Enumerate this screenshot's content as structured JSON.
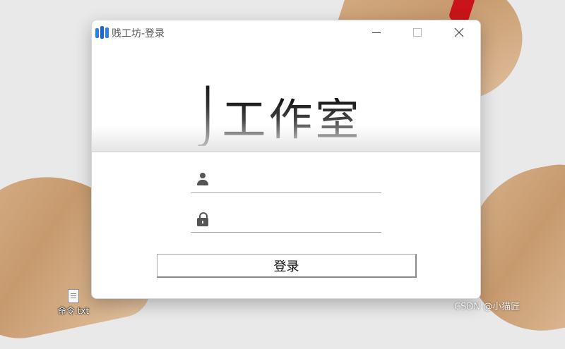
{
  "window": {
    "title": "贱工坊-登录",
    "logo_main": "J",
    "logo_rest": "工作室"
  },
  "form": {
    "username": {
      "value": "",
      "placeholder": ""
    },
    "password": {
      "value": "",
      "placeholder": ""
    },
    "login_label": "登录"
  },
  "desktop": {
    "icon_label": "命令.txt",
    "watermark": "CSDN @小猫匠"
  },
  "icons": {
    "app": "app-logo-icon",
    "user": "user-icon",
    "password": "lock-icon",
    "file": "text-file-icon"
  },
  "colors": {
    "app_icon_blue": "#2f7fe8",
    "ribbon_red": "#c9141b"
  }
}
